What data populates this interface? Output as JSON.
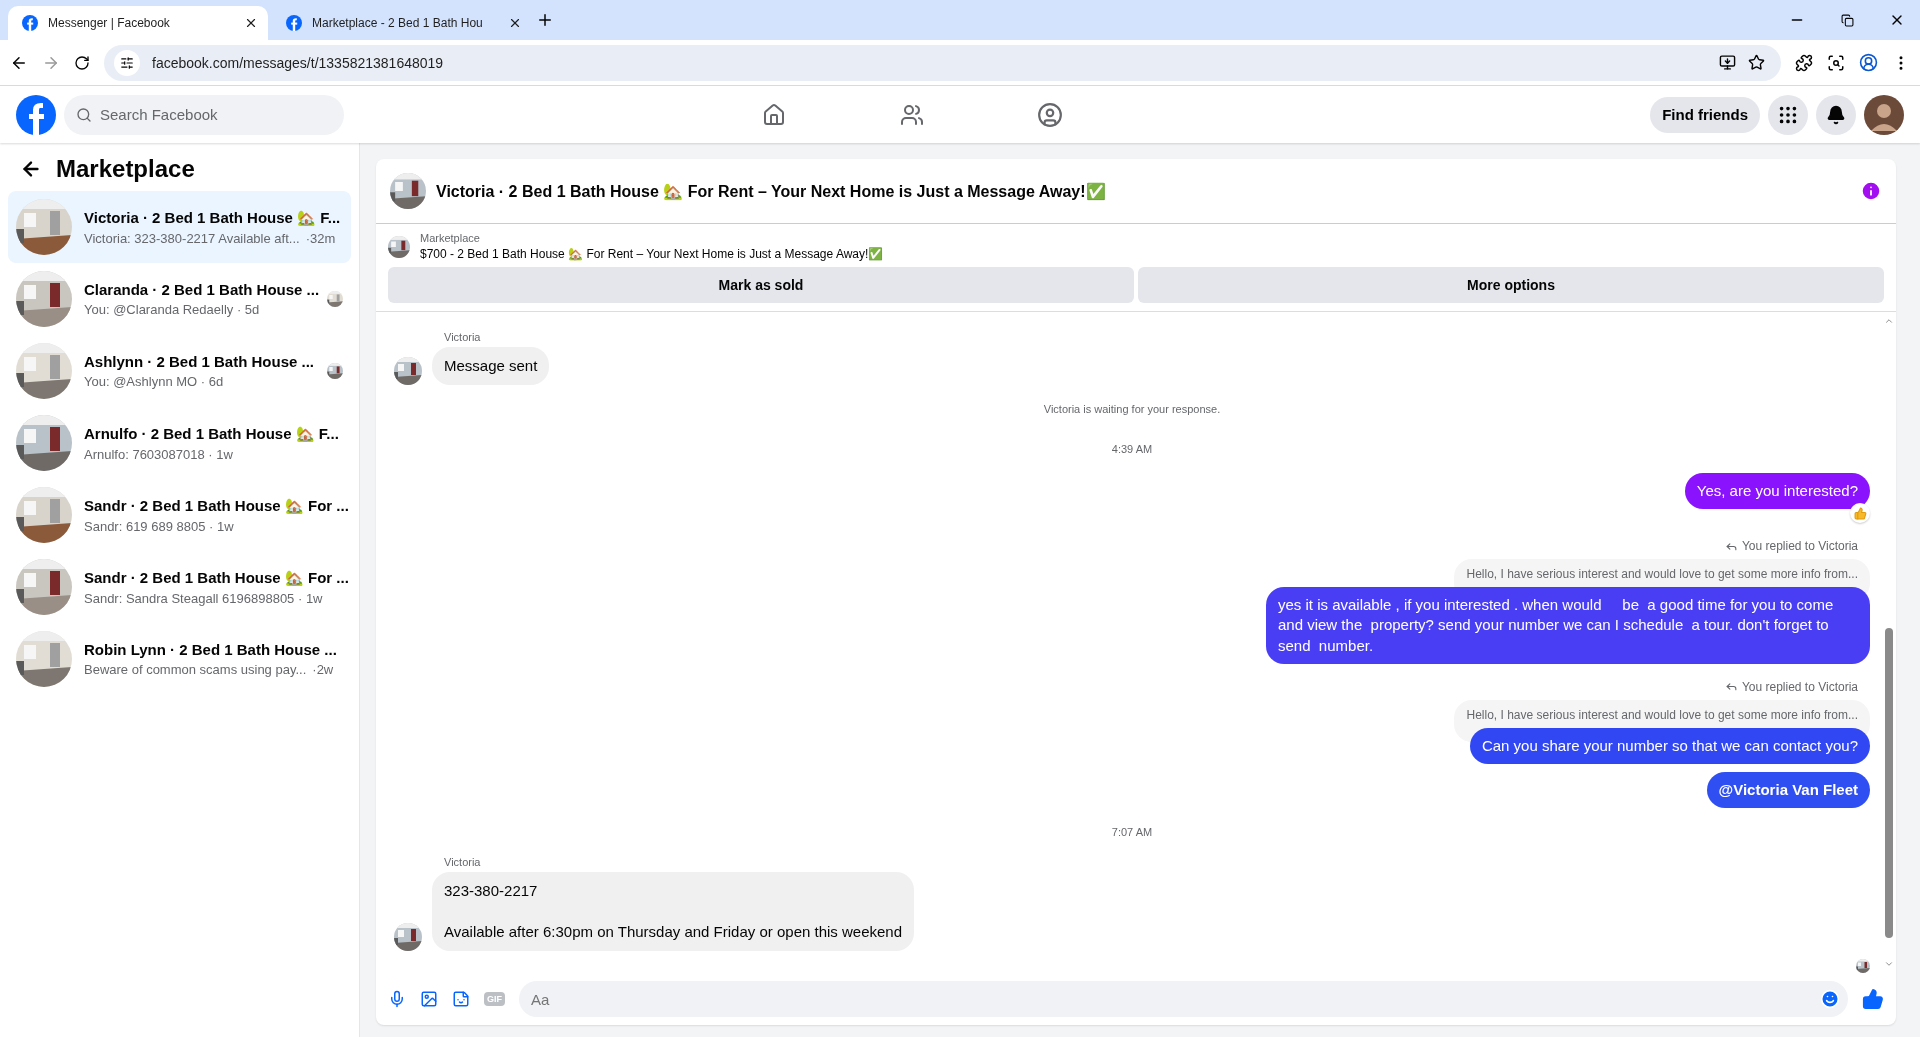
{
  "browser": {
    "tabs": [
      {
        "title": "Messenger | Facebook",
        "selected": true
      },
      {
        "title": "Marketplace - 2 Bed 1 Bath Hou",
        "selected": false
      }
    ],
    "url": "facebook.com/messages/t/1335821381648019"
  },
  "header": {
    "search_placeholder": "Search Facebook",
    "find_friends": "Find friends"
  },
  "sidebar": {
    "title": "Marketplace",
    "conversations": [
      {
        "title": "Victoria · 2 Bed 1 Bath House 🏡 F...",
        "preview": "Victoria: 323-380-2217 Available aft...",
        "time": "·32m",
        "selected": true,
        "seen_avatar": false
      },
      {
        "title": "Claranda · 2 Bed 1 Bath House ...",
        "preview": "You: @Claranda Redaelly · 5d",
        "selected": false,
        "seen_avatar": true
      },
      {
        "title": "Ashlynn · 2 Bed 1 Bath House ...",
        "preview": "You: @Ashlynn MO · 6d",
        "selected": false,
        "seen_avatar": true
      },
      {
        "title": "Arnulfo · 2 Bed 1 Bath House 🏡 F...",
        "preview": "Arnulfo: 7603087018 · 1w",
        "selected": false,
        "seen_avatar": false
      },
      {
        "title": "Sandr · 2 Bed 1 Bath House 🏡 For ...",
        "preview": "Sandr: 619 689 8805 · 1w",
        "selected": false,
        "seen_avatar": false
      },
      {
        "title": "Sandr · 2 Bed 1 Bath House 🏡 For ...",
        "preview": "Sandr: Sandra Steagall 6196898805 · 1w",
        "selected": false,
        "seen_avatar": false
      },
      {
        "title": "Robin Lynn · 2 Bed 1 Bath House ...",
        "preview": "Beware of common scams using pay...",
        "time": "·2w",
        "selected": false,
        "seen_avatar": false
      }
    ]
  },
  "chat": {
    "title": "Victoria · 2 Bed 1 Bath House 🏡 For Rent – Your Next Home is Just a Message Away!✅",
    "listing": {
      "source": "Marketplace",
      "title": "$700 - 2 Bed 1 Bath House 🏡 For Rent – Your Next Home is Just a Message Away!✅",
      "buttons": [
        "Mark as sold",
        "More options"
      ]
    },
    "messages": [
      {
        "kind": "incoming",
        "sender": "Victoria",
        "text": "Message sent"
      },
      {
        "kind": "notice",
        "text": "Victoria is waiting for your response."
      },
      {
        "kind": "time",
        "text": "4:39 AM"
      },
      {
        "kind": "outgoing",
        "text": "Yes, are you interested?",
        "color": "#8a12fc",
        "reaction": true
      },
      {
        "kind": "reply",
        "label": "You replied to Victoria",
        "quoted": "Hello, I have serious interest and would love to get some more info from...",
        "text": "yes it is available , if you interested . when would     be  a good time for you to come and view the  property? send your number we can I schedule  a tour. don't forget to send  number.",
        "color": "#4a3ef5"
      },
      {
        "kind": "reply",
        "label": "You replied to Victoria",
        "quoted": "Hello, I have serious interest and would love to get some more info from...",
        "text": "Can you share your number so that we can contact you?",
        "color": "#3147f3"
      },
      {
        "kind": "outgoing",
        "text": "@Victoria Van Fleet",
        "color": "#2f4ff2",
        "bold": true
      },
      {
        "kind": "time",
        "text": "7:07 AM"
      },
      {
        "kind": "incoming",
        "sender": "Victoria",
        "text": "323-380-2217\n\nAvailable after 6:30pm on Thursday and Friday or open this weekend"
      }
    ],
    "seen_avatar": true,
    "composer": {
      "gif": "GIF",
      "placeholder": "Aa"
    }
  }
}
